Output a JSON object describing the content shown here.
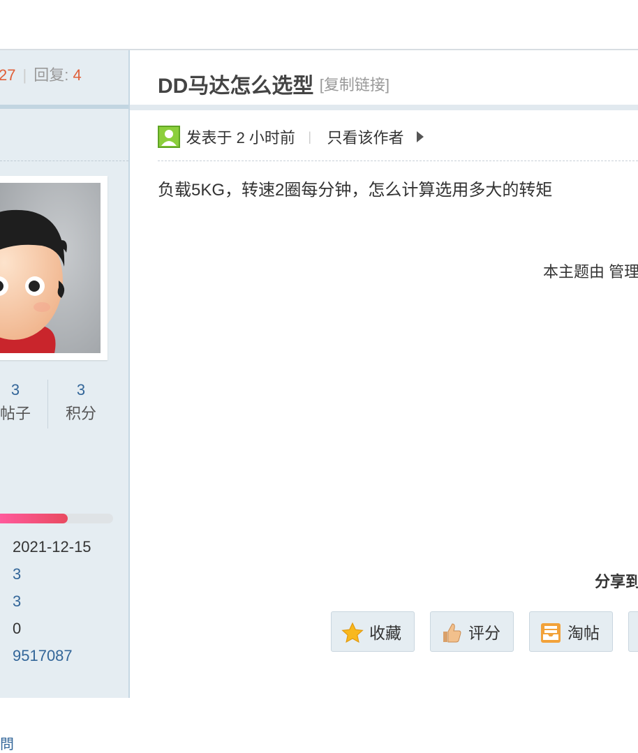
{
  "thread": {
    "views_value": "27",
    "replies_label": "回复:",
    "replies_value": "4",
    "title": "DD马达怎么选型",
    "copy_link": "[复制链接]"
  },
  "post": {
    "posted_time": "发表于 2 小时前",
    "only_author": "只看该作者",
    "body": "负载5KG，转速2圈每分钟，怎么计算选用多大的转矩",
    "mod_note": "本主题由 管理"
  },
  "user": {
    "posts_value": "3",
    "posts_label": "帖子",
    "credits_value": "3",
    "credits_label": "积分",
    "credit_progress_percent": 60,
    "info": [
      "2021-12-15",
      "3",
      "3",
      "0",
      "9517087"
    ],
    "bottom_link": "問"
  },
  "share": {
    "label": "分享到"
  },
  "actions": {
    "favorite": "收藏",
    "rate": "评分",
    "tao": "淘帖"
  },
  "colors": {
    "accent_orange": "#e0603a",
    "link_blue": "#336699",
    "side_bg": "#e5edf2"
  }
}
